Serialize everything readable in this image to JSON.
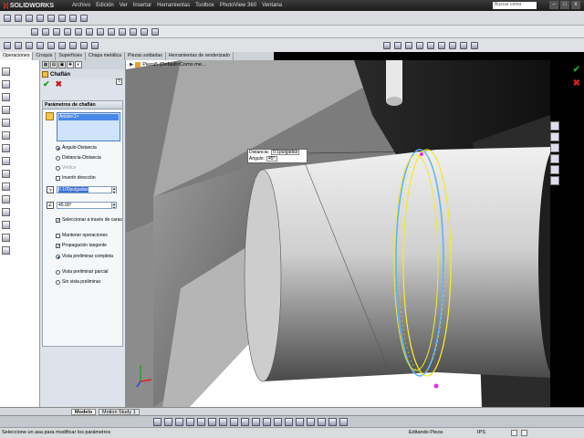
{
  "app": {
    "name": "SOLIDWORKS",
    "brand_color": "#cc2222"
  },
  "menubar": {
    "items": [
      "Archivo",
      "Edición",
      "Ver",
      "Insertar",
      "Herramientas",
      "Toolbox",
      "PhotoView 360",
      "Ventana"
    ]
  },
  "search": {
    "placeholder": "Buscar coma"
  },
  "window_buttons": [
    "–",
    "□",
    "x"
  ],
  "command_tabs": [
    "Operaciones",
    "Croquis",
    "Superficies",
    "Chapa metálica",
    "Piezas soldadas",
    "Herramientas de renderizado"
  ],
  "property_manager": {
    "title": "Chaflán",
    "help": "?",
    "ok": "✔",
    "cancel": "✖",
    "group_title": "Parámetros de chaflán",
    "selected_edge": "Arista<1>",
    "radio_angle_distance": "Ángulo-Distancia",
    "radio_distance_distance": "Distancia-Distancia",
    "radio_vertex": "Vértice",
    "check_reverse": "Invertir dirección",
    "distance_value": "0.100pulgadas",
    "angle_value": "45.00°",
    "check_select_through": "Seleccionar a través de caras",
    "check_keep_features": "Mantener operaciones",
    "check_tangent": "Propagación tangente",
    "radio_full_preview": "Vista preliminar completa",
    "radio_partial_preview": "Vista preliminar parcial",
    "radio_no_preview": "Sin vista preliminar"
  },
  "viewport": {
    "breadcrumb": "Pieza5 (Default<Como me...",
    "dim_distance_label": "Distancia:",
    "dim_distance_value": "0.1pulgadas",
    "dim_angle_label": "Ángulo:",
    "dim_angle_value": "45°",
    "accent_yellow": "#f2ea2a",
    "accent_blue": "#5ab4ff"
  },
  "bottom_tabs": [
    "Modelo",
    "Motion Study 1"
  ],
  "status": {
    "message": "Seleccione un asa para modificar los parámetros",
    "mode": "Editando Pieza",
    "zoom": "IPS"
  }
}
